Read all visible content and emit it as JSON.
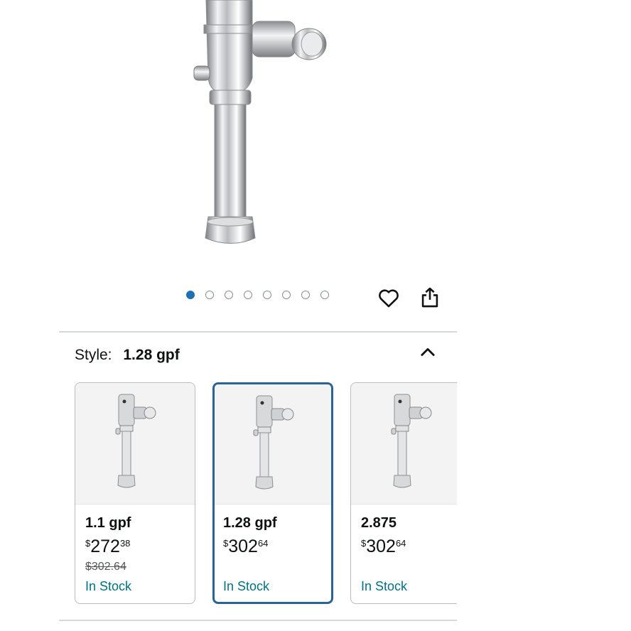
{
  "gallery": {
    "image_count": 8,
    "active_index": 0,
    "favorite_icon": "heart-icon",
    "share_icon": "share-icon",
    "dot_color_active": "#1f6fb5"
  },
  "style_selector": {
    "label": "Style:",
    "selected_value": "1.28 gpf",
    "collapse_icon": "chevron-up-icon",
    "options": [
      {
        "name": "1.1 gpf",
        "currency": "$",
        "price_whole": "272",
        "price_fraction": "38",
        "list_price": "$302.64",
        "availability": "In Stock",
        "selected": false
      },
      {
        "name": "1.28 gpf",
        "currency": "$",
        "price_whole": "302",
        "price_fraction": "64",
        "list_price": "",
        "availability": "In Stock",
        "selected": true
      },
      {
        "name": "2.875",
        "currency": "$",
        "price_whole": "302",
        "price_fraction": "64",
        "list_price": "",
        "availability": "In Stock",
        "selected": false
      }
    ]
  },
  "colors": {
    "selected_border": "#2a6496",
    "stock_text": "#007185"
  }
}
